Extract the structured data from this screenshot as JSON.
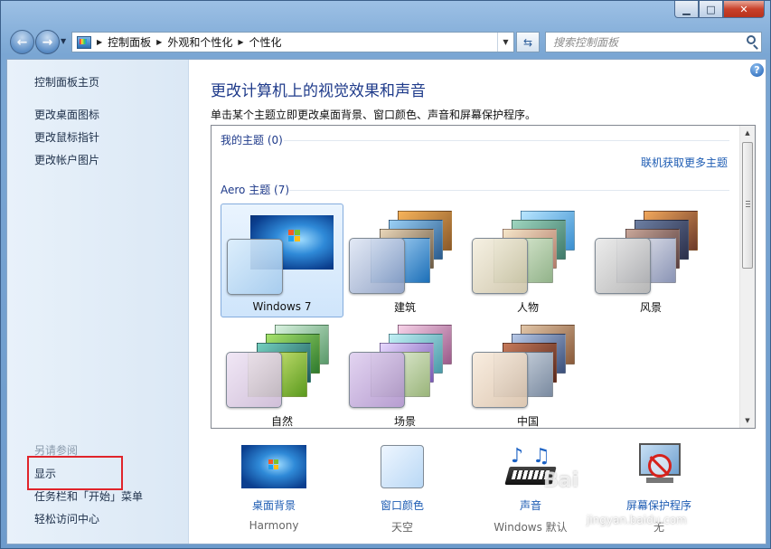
{
  "window": {
    "minimize_icon": "minimize-icon",
    "maximize_icon": "maximize-icon",
    "close_icon": "close-icon"
  },
  "navigation": {
    "breadcrumbs": [
      "控制面板",
      "外观和个性化",
      "个性化"
    ],
    "search_placeholder": "搜索控制面板",
    "refresh_icon": "refresh-icon"
  },
  "sidebar": {
    "home": "控制面板主页",
    "links": [
      "更改桌面图标",
      "更改鼠标指针",
      "更改帐户图片"
    ],
    "see_also_title": "另请参阅",
    "see_also": [
      "显示",
      "任务栏和「开始」菜单",
      "轻松访问中心"
    ]
  },
  "main": {
    "title": "更改计算机上的视觉效果和声音",
    "description": "单击某个主题立即更改桌面背景、窗口颜色、声音和屏幕保护程序。",
    "my_themes_label": "我的主题 (0)",
    "online_link": "联机获取更多主题",
    "aero_label": "Aero 主题 (7)",
    "themes": [
      "Windows 7",
      "建筑",
      "人物",
      "风景",
      "自然",
      "场景",
      "中国"
    ],
    "selected_theme": "Windows 7"
  },
  "bottom": {
    "items": [
      {
        "label": "桌面背景",
        "value": "Harmony"
      },
      {
        "label": "窗口颜色",
        "value": "天空"
      },
      {
        "label": "声音",
        "value": "Windows 默认"
      },
      {
        "label": "屏幕保护程序",
        "value": "无"
      }
    ]
  },
  "watermark": {
    "brand": "Bai",
    "site": "jingyan.baidu.com"
  },
  "colors": {
    "accent": "#1e3a8a",
    "link": "#1e5cb3",
    "highlight_box": "#e0242b"
  }
}
